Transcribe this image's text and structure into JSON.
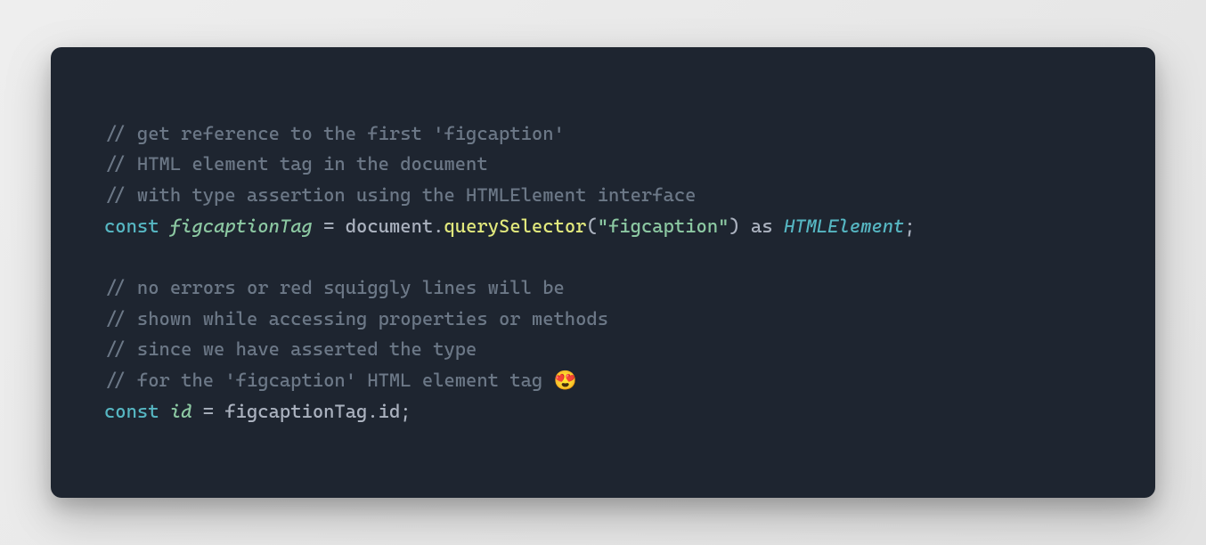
{
  "code": {
    "line1_comment": "// get reference to the first 'figcaption'",
    "line2_comment": "// HTML element tag in the document",
    "line3_comment": "// with type assertion using the HTMLElement interface",
    "line4_const": "const",
    "line4_var": "figcaptionTag",
    "line4_eq": " = ",
    "line4_obj": "document",
    "line4_dot1": ".",
    "line4_fn": "querySelector",
    "line4_lp": "(",
    "line4_str": "\"figcaption\"",
    "line4_rp": ")",
    "line4_as": " as ",
    "line4_type": "HTMLElement",
    "line4_semi": ";",
    "blank": "",
    "line5_comment": "// no errors or red squiggly lines will be",
    "line6_comment": "// shown while accessing properties or methods",
    "line7_comment": "// since we have asserted the type",
    "line8_comment": "// for the 'figcaption' HTML element tag 😍",
    "line9_const": "const",
    "line9_var": "id",
    "line9_eq": " = ",
    "line9_obj": "figcaptionTag",
    "line9_dot": ".",
    "line9_prop": "id",
    "line9_semi": ";"
  }
}
